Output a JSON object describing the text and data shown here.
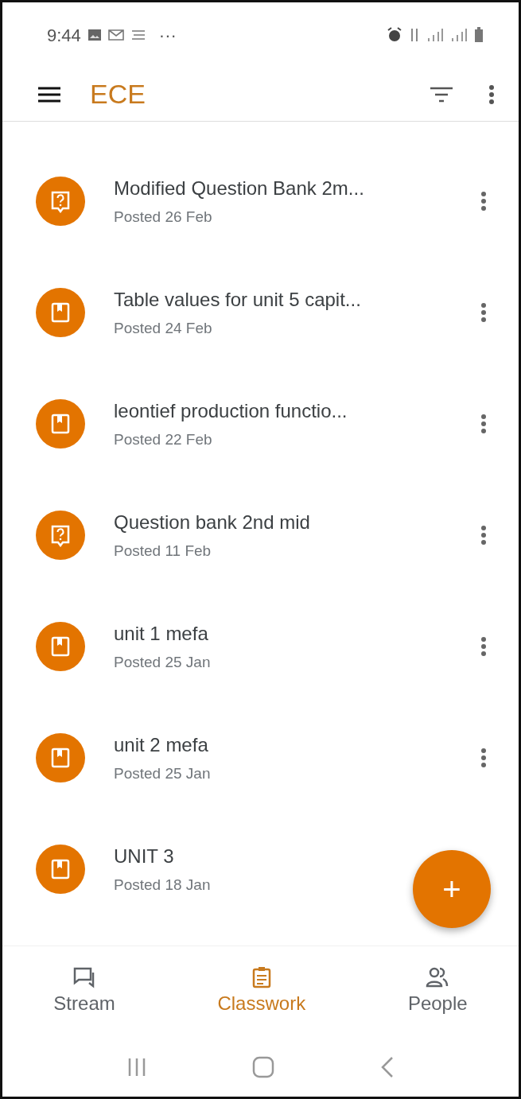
{
  "status_bar": {
    "time": "9:44",
    "overflow": "···"
  },
  "app_bar": {
    "title": "ECE"
  },
  "items": [
    {
      "kind": "question",
      "title": "Modified Question Bank 2m...",
      "posted": "Posted 26 Feb",
      "menu": true
    },
    {
      "kind": "material",
      "title": "Table values for unit 5 capit...",
      "posted": "Posted 24 Feb",
      "menu": true
    },
    {
      "kind": "material",
      "title": "leontief production functio...",
      "posted": "Posted 22 Feb",
      "menu": true
    },
    {
      "kind": "question",
      "title": "Question bank 2nd mid",
      "posted": "Posted 11 Feb",
      "menu": true
    },
    {
      "kind": "material",
      "title": "unit 1 mefa",
      "posted": "Posted 25 Jan",
      "menu": true
    },
    {
      "kind": "material",
      "title": "unit 2 mefa",
      "posted": "Posted 25 Jan",
      "menu": true
    },
    {
      "kind": "material",
      "title": "UNIT 3",
      "posted": "Posted 18 Jan",
      "menu": false
    }
  ],
  "fab": {
    "label": "+"
  },
  "bottom_nav": [
    {
      "kind": "stream",
      "label": "Stream",
      "selected": false
    },
    {
      "kind": "classwork",
      "label": "Classwork",
      "selected": true
    },
    {
      "kind": "people",
      "label": "People",
      "selected": false
    }
  ]
}
